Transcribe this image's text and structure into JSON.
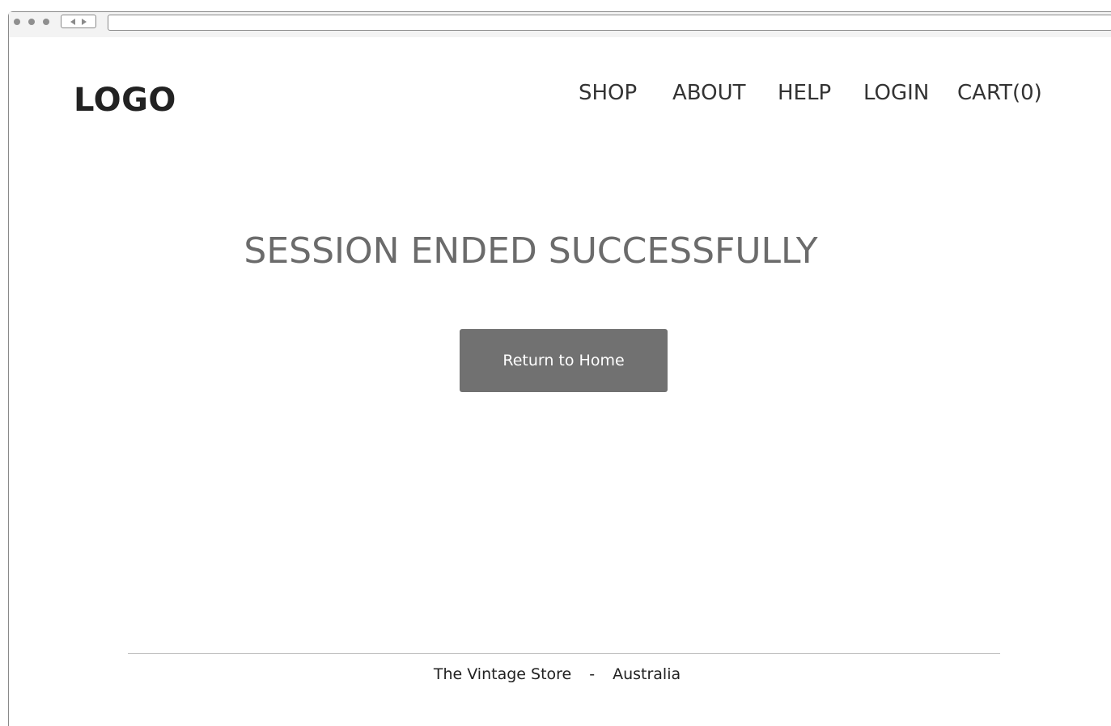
{
  "header": {
    "logo": "LOGO",
    "nav": [
      {
        "label": "SHOP"
      },
      {
        "label": "ABOUT"
      },
      {
        "label": "HELP"
      },
      {
        "label": "LOGIN"
      },
      {
        "label": "CART(0)"
      }
    ]
  },
  "main": {
    "headline": "SESSION ENDED SUCCESSFULLY",
    "return_button": "Return to Home"
  },
  "footer": {
    "store": "The Vintage Store",
    "separator": "-",
    "country": "Australia"
  },
  "colors": {
    "button_bg": "#717171",
    "headline": "#6b6b6b",
    "text": "#222222"
  }
}
